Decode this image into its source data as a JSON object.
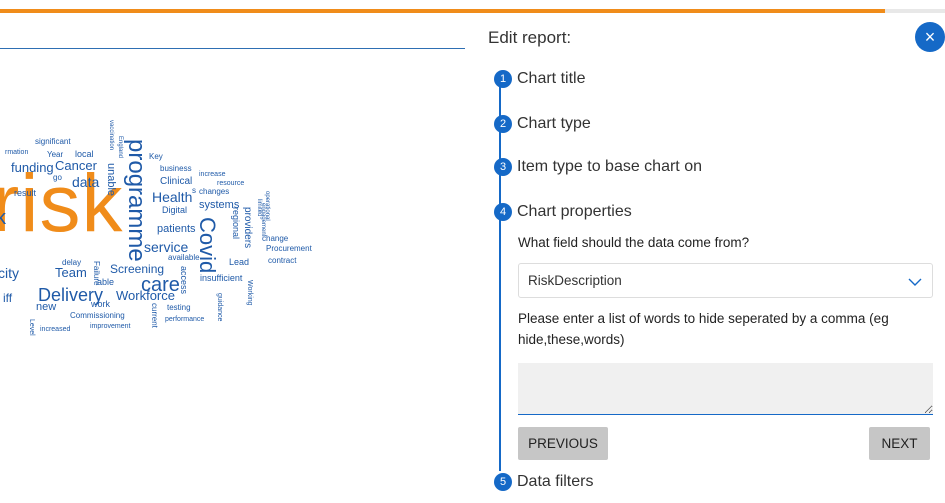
{
  "wordcloud": {
    "words": [
      "risk",
      "programme",
      "Covid",
      "care",
      "Delivery",
      "funding",
      "Cancer",
      "data",
      "Health",
      "service",
      "Team",
      "Workforce",
      "Screening",
      "patients",
      "city",
      "iff",
      "systems",
      "Digital",
      "Clinical",
      "business",
      "Key",
      "resource",
      "increase",
      "changes",
      "providers",
      "regional",
      "Lead",
      "Procurement",
      "contract",
      "change",
      "insufficient",
      "access",
      "available",
      "delay",
      "Failure",
      "able",
      "new",
      "work",
      "Commissioning",
      "improvement",
      "increased",
      "testing",
      "performance",
      "current",
      "guidance",
      "Working",
      "significant",
      "Year",
      "local",
      "rmation",
      "result",
      "go",
      "unable",
      "vaccination",
      "England",
      "operational",
      "limited",
      "engagement",
      "Level",
      "k",
      "s"
    ]
  },
  "panel": {
    "title": "Edit report:",
    "close_icon": "×",
    "steps": [
      {
        "num": "1",
        "label": "Chart title"
      },
      {
        "num": "2",
        "label": "Chart type"
      },
      {
        "num": "3",
        "label": "Item type to base chart on"
      },
      {
        "num": "4",
        "label": "Chart properties"
      },
      {
        "num": "5",
        "label": "Data filters"
      }
    ],
    "field_question": "What field should the data come from?",
    "field_value": "RiskDescription",
    "hide_words_question": "Please enter a list of words to hide seperated by a comma (eg hide,these,words)",
    "hide_words_value": "",
    "previous_label": "PREVIOUS",
    "next_label": "NEXT"
  },
  "colors": {
    "accent": "#1569c7",
    "orange": "#f08c1a",
    "word_blue": "#1f5aa8",
    "word_orange": "#f08c1a"
  }
}
